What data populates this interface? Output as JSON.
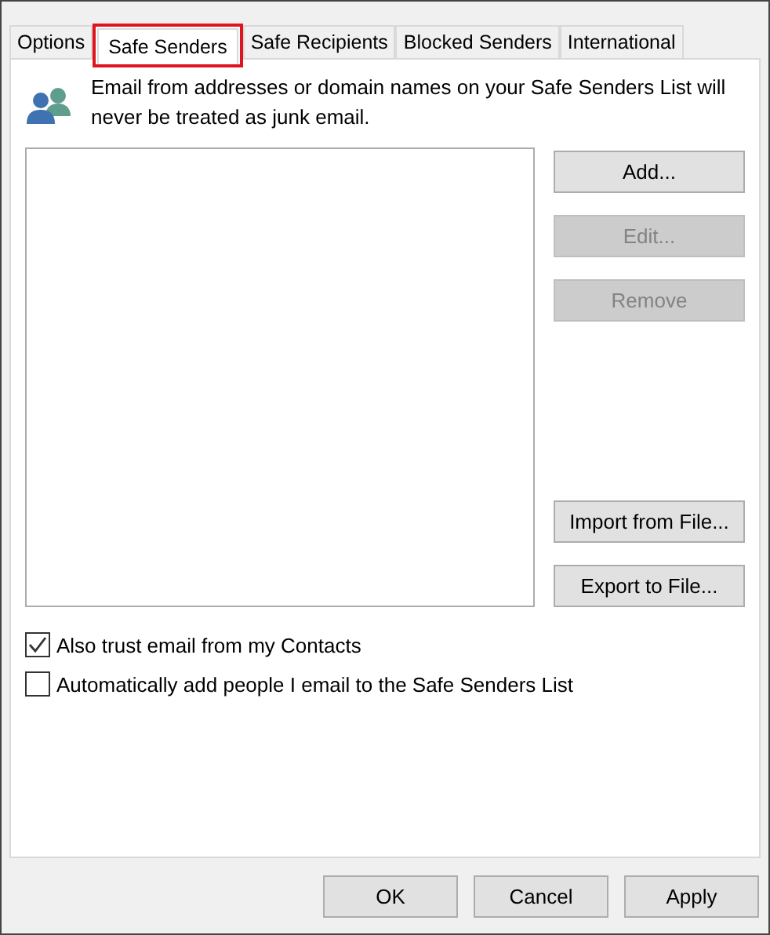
{
  "tabs": [
    {
      "label": "Options",
      "selected": false,
      "highlighted": false
    },
    {
      "label": "Safe Senders",
      "selected": true,
      "highlighted": true
    },
    {
      "label": "Safe Recipients",
      "selected": false,
      "highlighted": false
    },
    {
      "label": "Blocked Senders",
      "selected": false,
      "highlighted": false
    },
    {
      "label": "International",
      "selected": false,
      "highlighted": false
    }
  ],
  "description": "Email from addresses or domain names on your Safe Senders List will never be treated as junk email.",
  "list_buttons": [
    {
      "label": "Add...",
      "disabled": false
    },
    {
      "label": "Edit...",
      "disabled": true
    },
    {
      "label": "Remove",
      "disabled": true
    }
  ],
  "file_buttons": [
    {
      "label": "Import from File...",
      "disabled": false
    },
    {
      "label": "Export to File...",
      "disabled": false
    }
  ],
  "checkboxes": [
    {
      "label": "Also trust email from my Contacts",
      "checked": true
    },
    {
      "label": "Automatically add people I email to the Safe Senders List",
      "checked": false
    }
  ],
  "buttons": [
    "OK",
    "Cancel",
    "Apply"
  ]
}
